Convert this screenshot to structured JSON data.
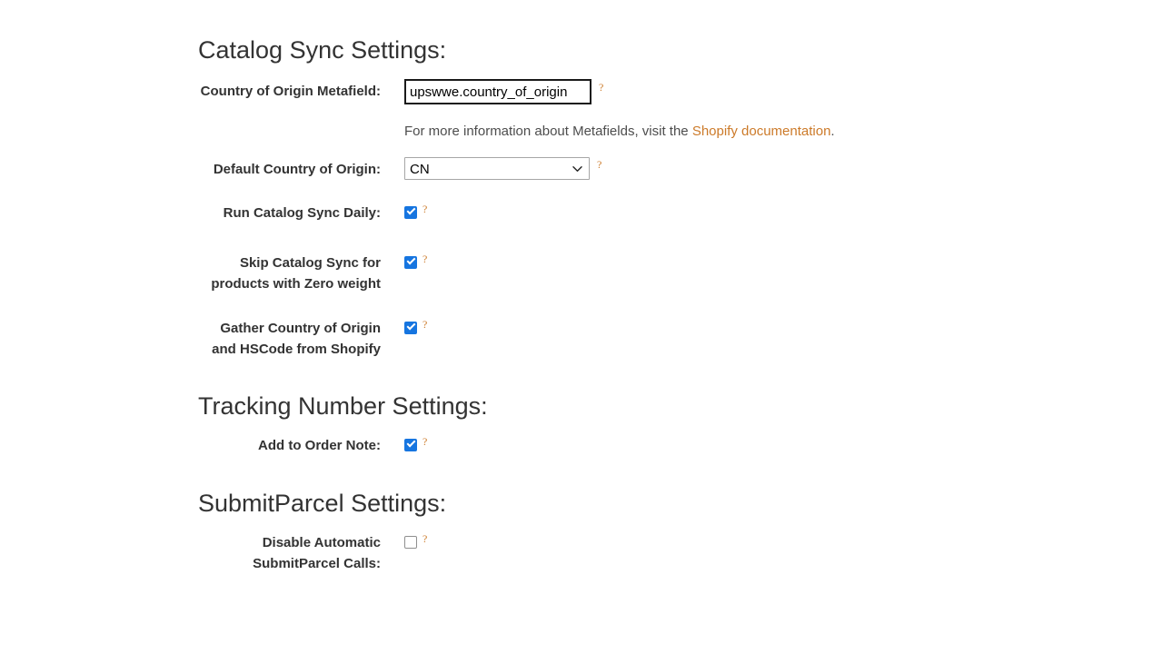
{
  "sections": [
    {
      "heading": "Catalog Sync Settings:",
      "fields": [
        {
          "label": "Country of Origin Metafield:",
          "type": "text",
          "value": "upswwe.country_of_origin",
          "placeholder": "",
          "help_marker": "?"
        },
        {
          "label": "Default Country of Origin:",
          "type": "select",
          "value": "CN",
          "options": [
            "CN"
          ],
          "help_marker": "?"
        },
        {
          "label": "Run Catalog Sync Daily:",
          "type": "checkbox",
          "checked": true,
          "help_marker": "?"
        },
        {
          "label": "Skip Catalog Sync for products with Zero weight",
          "type": "checkbox",
          "checked": true,
          "help_marker": "?"
        },
        {
          "label": "Gather Country of Origin and HSCode from Shopify",
          "type": "checkbox",
          "checked": true,
          "help_marker": "?"
        }
      ]
    },
    {
      "heading": "Tracking Number Settings:",
      "fields": [
        {
          "label": "Add to Order Note:",
          "type": "checkbox",
          "checked": true,
          "help_marker": "?"
        }
      ]
    },
    {
      "heading": "SubmitParcel Settings:",
      "fields": [
        {
          "label": "Disable Automatic SubmitParcel Calls:",
          "type": "checkbox",
          "checked": false,
          "help_marker": "?"
        }
      ]
    }
  ],
  "metafield_help": {
    "text_before": "For more information about Metafields, visit the ",
    "link_label": "Shopify documentation",
    "text_after": "."
  },
  "icons": {
    "select_chevron": "chevron-down-icon",
    "help": "question-mark-icon",
    "checkmark": "checkmark-icon"
  },
  "colors": {
    "heading": "#333333",
    "label": "#333333",
    "body_text": "#4d4d4d",
    "link": "#cc7a29",
    "help_marker": "#cc7a29",
    "checkbox_checked": "#1675e0",
    "checkbox_border": "#8f8f8f",
    "input_border_focus": "#1a1a1a",
    "select_border": "#a6a6a6",
    "background": "#ffffff"
  }
}
